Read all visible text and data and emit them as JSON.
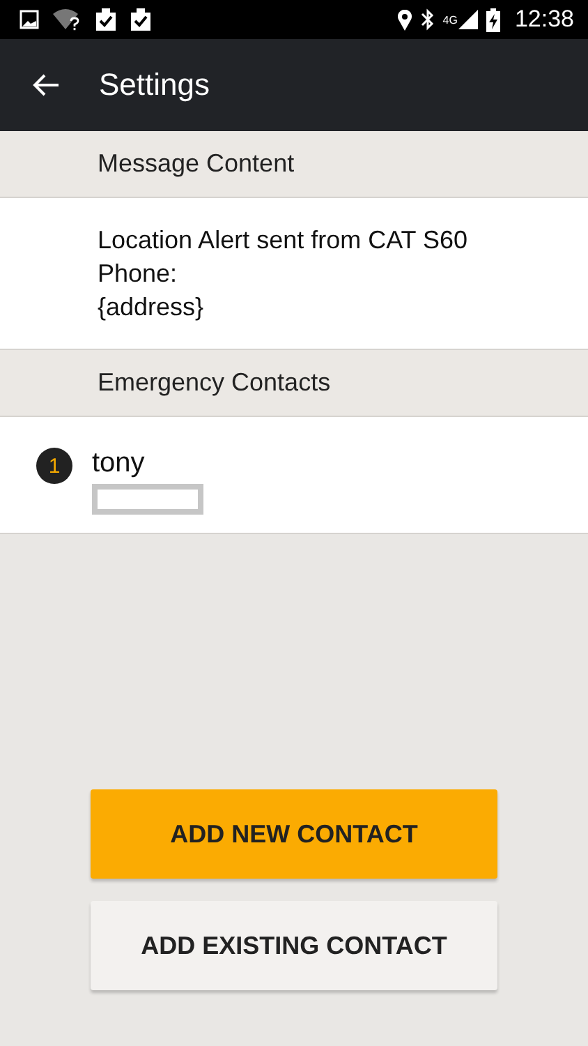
{
  "status_bar": {
    "network": "4G",
    "time": "12:38"
  },
  "app_bar": {
    "title": "Settings"
  },
  "sections": [
    {
      "header": "Message Content",
      "message": "Location Alert sent from CAT S60 Phone:\n{address}"
    },
    {
      "header": "Emergency Contacts",
      "contacts": [
        {
          "number": "1",
          "name": "tony"
        }
      ]
    }
  ],
  "buttons": [
    {
      "label": "ADD NEW CONTACT",
      "kind": "primary"
    },
    {
      "label": "ADD EXISTING CONTACT",
      "kind": "secondary"
    }
  ]
}
